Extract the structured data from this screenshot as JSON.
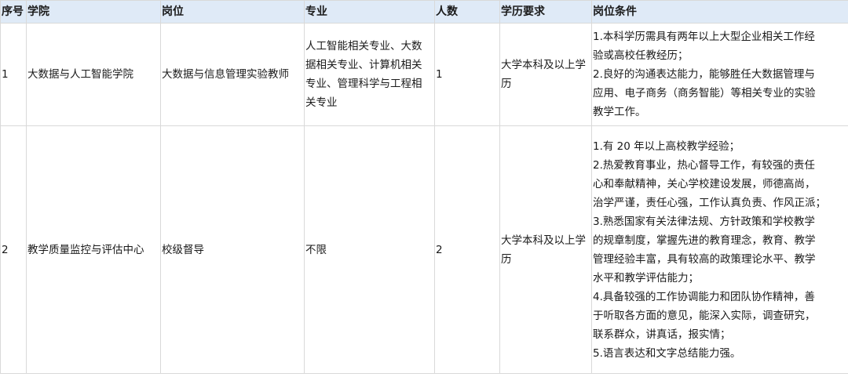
{
  "headers": [
    "序号",
    "学院",
    "岗位",
    "专业",
    "人数",
    "学历要求",
    "岗位条件"
  ],
  "rows": [
    {
      "no": "1",
      "college": "大数据与人工智能学院",
      "position": "大数据与信息管理实验教师",
      "major": [
        "人工智能相关专业、大数",
        "据相关专业、计算机相关",
        "专业、管理科学与工程相",
        "关专业"
      ],
      "count": "1",
      "education": "大学本科及以上学历",
      "conditions": [
        "1.本科学历需具有两年以上大型企业相关工作经",
        "验或高校任教经历；",
        "2.良好的沟通表达能力，能够胜任大数据管理与",
        "应用、电子商务（商务智能）等相关专业的实验",
        "教学工作。"
      ]
    },
    {
      "no": "2",
      "college": "教学质量监控与评估中心",
      "position": "校级督导",
      "major": [
        "不限"
      ],
      "count": "2",
      "education": "大学本科及以上学历",
      "conditions": [
        "1.有 20 年以上高校教学经验；",
        "2.热爱教育事业，热心督导工作，有较强的责任",
        "心和奉献精神，关心学校建设发展，师德高尚，",
        "治学严谨，责任心强，工作认真负责、作风正派；",
        "3.熟悉国家有关法律法规、方针政策和学校教学",
        "的规章制度，掌握先进的教育理念，教育、教学",
        "管理经验丰富，具有较高的政策理论水平、教学",
        "水平和教学评估能力；",
        "4.具备较强的工作协调能力和团队协作精神，善",
        "于听取各方面的意见，能深入实际，调查研究，",
        "联系群众，讲真话，报实情；",
        "5.语言表达和文字总结能力强。"
      ]
    }
  ]
}
